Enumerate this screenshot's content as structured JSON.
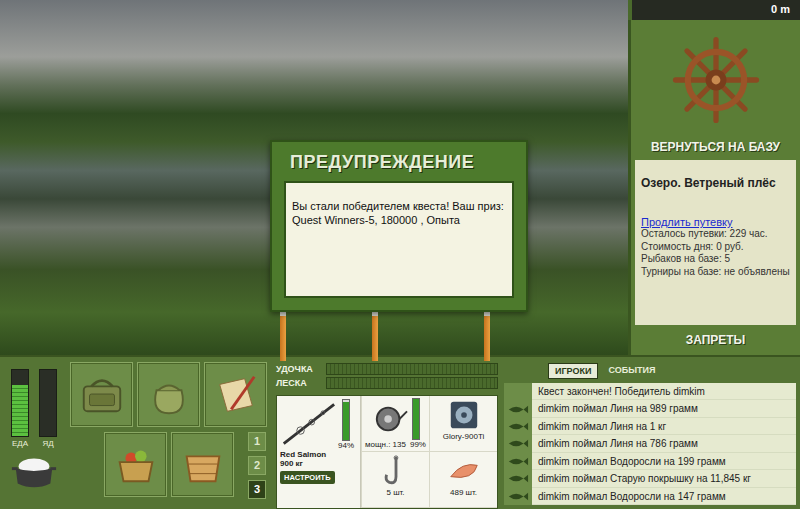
{
  "distance": "0 m",
  "dialog": {
    "title": "ПРЕДУПРЕЖДЕНИЕ",
    "message": "Вы стали победителем квеста! Ваш приз: Quest Winners-5, 180000 , Опыта"
  },
  "location": {
    "back_button": "ВЕРНУТЬСЯ НА БАЗУ",
    "name": "Озеро. Ветреный плёс",
    "extend_link": "Продлить путевку",
    "details": [
      "Осталось путевки: 229 час.",
      "Стоимость дня: 0 руб.",
      "Рыбаков на базе: 5",
      "Турниры на базе: не объявлены"
    ],
    "bans_button": "ЗАПРЕТЫ"
  },
  "meters": [
    {
      "label": "ЕДА",
      "level": 0.78
    },
    {
      "label": "ЯД",
      "level": 0
    }
  ],
  "inventory_pages": [
    {
      "label": "1",
      "selected": false
    },
    {
      "label": "2",
      "selected": false
    },
    {
      "label": "3",
      "selected": true
    }
  ],
  "tackle_bars": [
    {
      "label": "УДОЧКА",
      "level": 0
    },
    {
      "label": "ЛЕСКА",
      "level": 0
    }
  ],
  "rod": {
    "name": "Red Salmon",
    "capacity": "900 кг",
    "wear": "94%",
    "level": 0.94,
    "setup_button": "НАСТРОИТЬ"
  },
  "reel": {
    "power": "мощн.: 135",
    "wear": "99%",
    "level": 0.99
  },
  "line": {
    "name": "Glory-900Ti"
  },
  "hook": {
    "count": "5 шт."
  },
  "bait": {
    "count": "489 шт."
  },
  "tabs": [
    {
      "label": "ИГРОКИ",
      "selected": true
    },
    {
      "label": "СОБЫТИЯ",
      "selected": false
    }
  ],
  "events": [
    {
      "kind": "notice",
      "text": "Квест закончен! Победитель dimkim"
    },
    {
      "kind": "catch",
      "text": "dimkim поймал Линя на 989 грамм"
    },
    {
      "kind": "catch",
      "text": "dimkim поймал Линя на 1 кг"
    },
    {
      "kind": "catch",
      "text": "dimkim поймал Линя на 786 грамм"
    },
    {
      "kind": "catch",
      "text": "dimkim поймал Водоросли на 199 грамм"
    },
    {
      "kind": "catch",
      "text": "dimkim поймал Старую покрышку на 11,845 кг"
    },
    {
      "kind": "catch",
      "text": "dimkim поймал Водоросли на 147 грамм"
    }
  ]
}
